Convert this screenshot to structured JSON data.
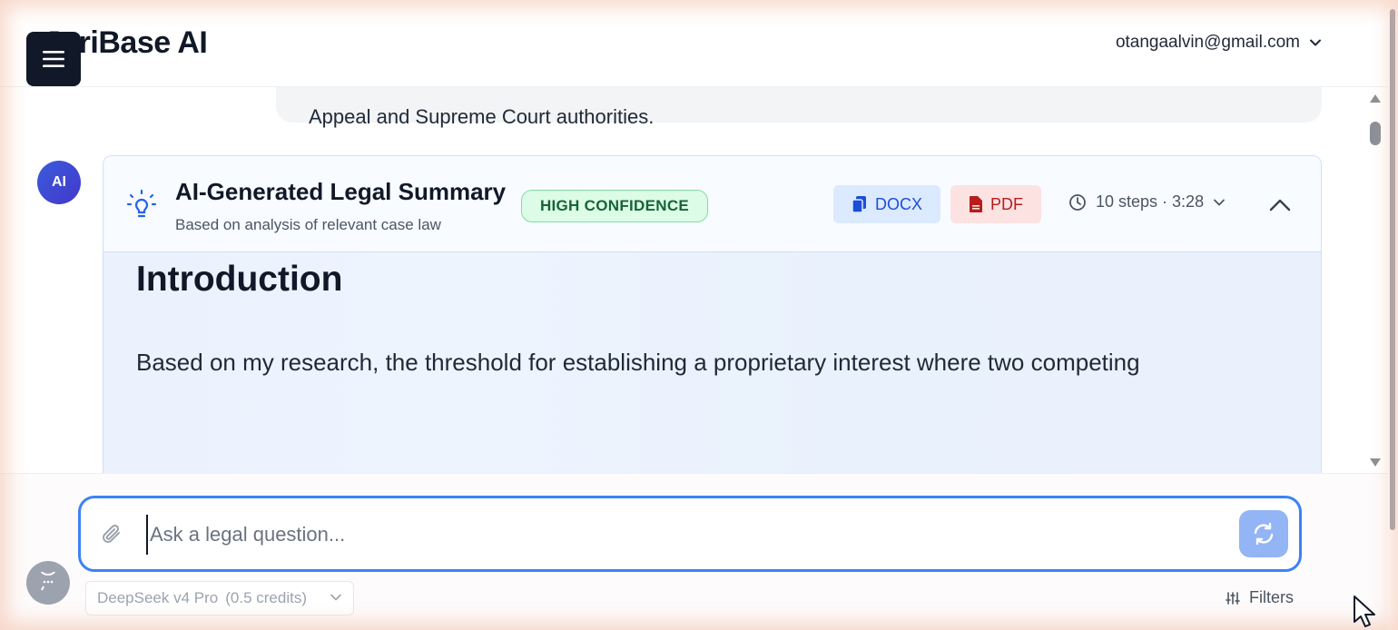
{
  "header": {
    "brand": "JuriBase AI",
    "account_email": "otangaalvin@gmail.com"
  },
  "previous_message": {
    "text": "Appeal and Supreme Court authorities."
  },
  "ai_message": {
    "avatar_label": "AI",
    "title": "AI-Generated Legal Summary",
    "subtitle": "Based on analysis of relevant case law",
    "confidence_badge": "HIGH CONFIDENCE",
    "docx_label": "DOCX",
    "pdf_label": "PDF",
    "steps_label": "10 steps · 3:28",
    "heading": "Introduction",
    "body_text": "Based on my research, the threshold for establishing a proprietary interest where two competing"
  },
  "composer": {
    "placeholder": "Ask a legal question...",
    "model_name": "DeepSeek v4 Pro",
    "model_credits": "(0.5 credits)",
    "filters_label": "Filters"
  },
  "colors": {
    "accent": "#3b82f6",
    "brand_dark": "#111827",
    "confidence_green": "#166534",
    "docx_blue": "#1d4ed8",
    "pdf_red": "#b91c1c"
  }
}
